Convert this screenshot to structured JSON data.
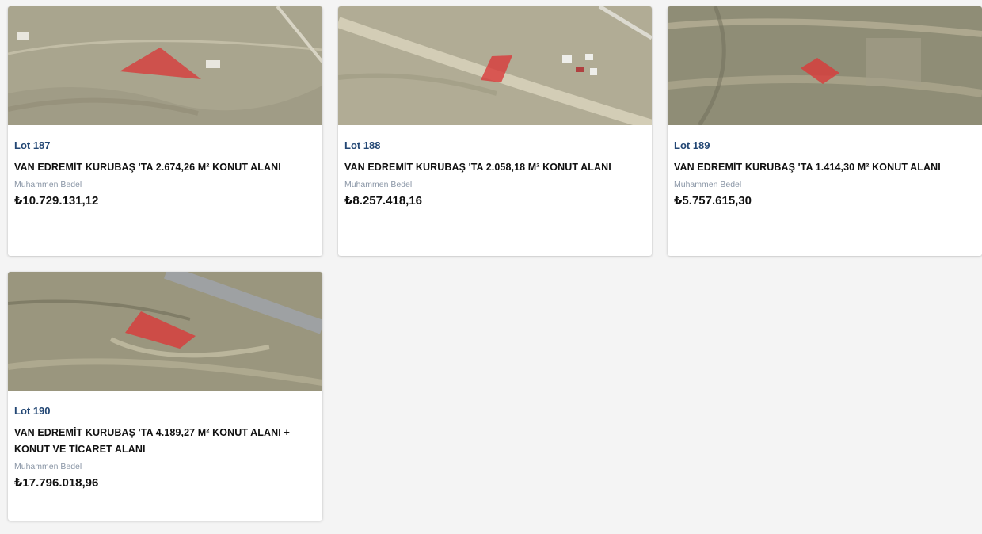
{
  "listings": [
    {
      "lot": "Lot 187",
      "title": "VAN EDREMİT KURUBAŞ 'TA 2.674,26 M² KONUT ALANI",
      "price_label": "Muhammen Bedel",
      "price": "₺10.729.131,12"
    },
    {
      "lot": "Lot 188",
      "title": "VAN EDREMİT KURUBAŞ 'TA 2.058,18 M² KONUT ALANI",
      "price_label": "Muhammen Bedel",
      "price": "₺8.257.418,16"
    },
    {
      "lot": "Lot 189",
      "title": "VAN EDREMİT KURUBAŞ 'TA 1.414,30 M² KONUT ALANI",
      "price_label": "Muhammen Bedel",
      "price": "₺5.757.615,30"
    },
    {
      "lot": "Lot 190",
      "title": "VAN EDREMİT KURUBAŞ 'TA 4.189,27 M² KONUT ALANI + KONUT VE TİCARET ALANI",
      "price_label": "Muhammen Bedel",
      "price": "₺17.796.018,96"
    }
  ],
  "colors": {
    "page_background": "#f4f4f4",
    "lot_label": "#234774",
    "parcel_highlight": "#d93a3a",
    "terrain": "#a9a58e"
  }
}
